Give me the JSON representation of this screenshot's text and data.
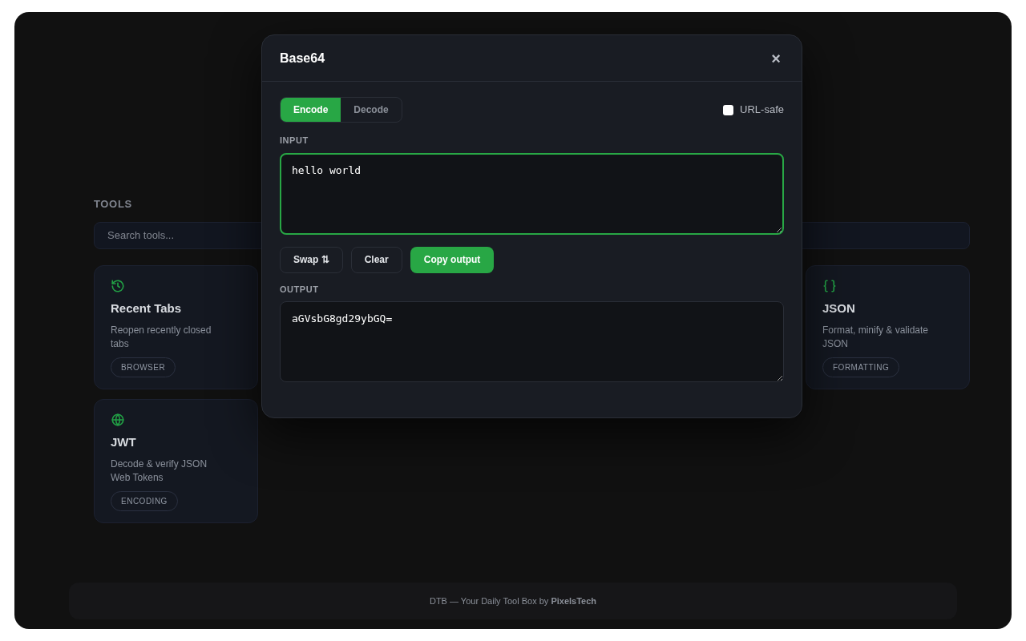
{
  "background": {
    "section_title": "TOOLS",
    "search": {
      "placeholder": "Search tools..."
    },
    "cards": [
      {
        "title": "Recent Tabs",
        "description": "Reopen recently closed tabs",
        "tag": "BROWSER"
      },
      {
        "title": "JSON",
        "description": "Format, minify & validate JSON",
        "tag": "FORMATTING"
      },
      {
        "title": "JWT",
        "description": "Decode & verify JSON Web Tokens",
        "tag": "ENCODING"
      }
    ],
    "footer": "DTB — Your Daily Tool Box by **PixelsTech**"
  },
  "dialog": {
    "title": "Base64",
    "close": "×",
    "modes": [
      {
        "label": "Encode",
        "selected": true
      },
      {
        "label": "Decode",
        "selected": false
      }
    ],
    "url_safe": {
      "label": "URL-safe",
      "checked": false
    },
    "input": {
      "label": "INPUT",
      "value": "hello world"
    },
    "actions": [
      {
        "label": "Swap ⇅",
        "kind": "outline"
      },
      {
        "label": "Clear",
        "kind": "outline"
      },
      {
        "label": "Copy output",
        "kind": "primary"
      }
    ],
    "output": {
      "label": "OUTPUT",
      "value": "aGVsbG8gd29ybGQ="
    }
  }
}
